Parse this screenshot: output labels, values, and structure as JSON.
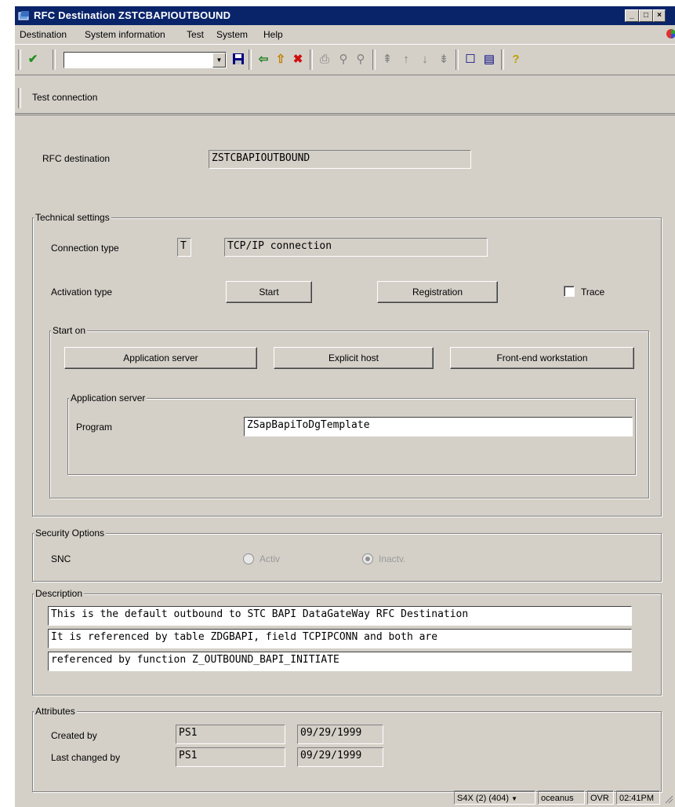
{
  "window": {
    "title": "RFC Destination ZSTCBAPIOUTBOUND"
  },
  "menu": {
    "items": [
      {
        "label": "Destination"
      },
      {
        "label": "System information"
      },
      {
        "label": "Test"
      },
      {
        "label": "System"
      },
      {
        "label": "Help"
      }
    ]
  },
  "toolbar": {
    "icons": [
      "enter-checkmark-icon",
      "save-icon",
      "back-icon",
      "exit-icon",
      "cancel-icon",
      "print-icon",
      "find-icon",
      "find-next-icon",
      "first-page-icon",
      "previous-page-icon",
      "next-page-icon",
      "last-page-icon",
      "create-session-icon",
      "shortcut-icon",
      "help-icon"
    ],
    "command_value": ""
  },
  "app_toolbar": {
    "test_connection": "Test connection"
  },
  "rfc": {
    "label": "RFC destination",
    "value": "ZSTCBAPIOUTBOUND"
  },
  "technical": {
    "title": "Technical settings",
    "connection_type_label": "Connection type",
    "connection_type_code": "T",
    "connection_type_desc": "TCP/IP connection",
    "activation_type_label": "Activation type",
    "start_button": "Start",
    "registration_button": "Registration",
    "trace_label": "Trace",
    "trace_checked": false,
    "start_on": {
      "title": "Start on",
      "app_server_button": "Application server",
      "explicit_host_button": "Explicit host",
      "frontend_button": "Front-end workstation",
      "app_server_group": {
        "title": "Application server",
        "program_label": "Program",
        "program_value": "ZSapBapiToDgTemplate"
      }
    }
  },
  "security": {
    "title": "Security Options",
    "snc_label": "SNC",
    "activ_label": "Activ",
    "inactv_label": "Inactv.",
    "selected": "Inactv."
  },
  "description": {
    "title": "Description",
    "lines": [
      "This is the default outbound to STC BAPI DataGateWay RFC Destination",
      "It is referenced by table ZDGBAPI, field TCPIPCONN and both are",
      "referenced by function Z_OUTBOUND_BAPI_INITIATE"
    ]
  },
  "attributes": {
    "title": "Attributes",
    "created_by_label": "Created by",
    "created_by_user": "PS1",
    "created_by_date": "09/29/1999",
    "changed_by_label": "Last changed by",
    "changed_by_user": "PS1",
    "changed_by_date": "09/29/1999"
  },
  "status": {
    "system": "S4X (2) (404)",
    "server": "oceanus",
    "mode": "OVR",
    "time": "02:41PM"
  }
}
